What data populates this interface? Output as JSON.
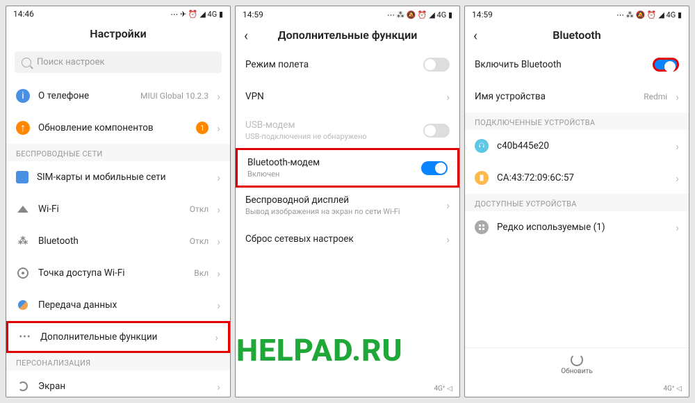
{
  "watermark": "HELPAD.RU",
  "screen1": {
    "time": "14:46",
    "status_right": "⋯ ✈ ⏰ ◢ 4G ▮",
    "title": "Настройки",
    "search_placeholder": "Поиск настроек",
    "about": {
      "label": "О телефоне",
      "value": "MIUI Global 10.2.3"
    },
    "update": {
      "label": "Обновление компонентов",
      "badge": "1"
    },
    "section_wireless": "БЕСПРОВОДНЫЕ СЕТИ",
    "sim": "SIM-карты и мобильные сети",
    "wifi": {
      "label": "Wi-Fi",
      "value": "Откл"
    },
    "bluetooth": {
      "label": "Bluetooth",
      "value": "Откл"
    },
    "hotspot": {
      "label": "Точка доступа Wi-Fi",
      "value": "Вкл"
    },
    "data": "Передача данных",
    "more": "Дополнительные функции",
    "section_personal": "ПЕРСОНАЛИЗАЦИЯ",
    "screen": "Экран"
  },
  "screen2": {
    "time": "14:59",
    "status_right": "⋯ ⁂ 🔕 ⏰ ◢ 4G ▮",
    "title": "Дополнительные функции",
    "airplane": "Режим полета",
    "vpn": "VPN",
    "usb": {
      "label": "USB-модем",
      "sub": "USB-подключения не обнаружено"
    },
    "btmodem": {
      "label": "Bluetooth-модем",
      "sub": "Включен"
    },
    "cast": {
      "label": "Беспроводной дисплей",
      "sub": "Вывод изображения на экран по сети Wi-Fi"
    },
    "reset": "Сброс сетевых настроек",
    "nav": "4G⁺ ◁"
  },
  "screen3": {
    "time": "14:59",
    "status_right": "⋯ ⁂ 🔕 ⏰ ◢ 4G ▮",
    "title": "Bluetooth",
    "enable": "Включить Bluetooth",
    "name": {
      "label": "Имя устройства",
      "value": "Redmi"
    },
    "section_paired": "ПОДКЛЮЧЕННЫЕ УСТРОЙСТВА",
    "dev1": "c40b445e20",
    "dev2": "CA:43:72:09:6C:57",
    "section_available": "ДОСТУПНЫЕ УСТРОЙСТВА",
    "rare": "Редко используемые (1)",
    "refresh": "Обновить",
    "nav": "4G⁺ ◁"
  }
}
